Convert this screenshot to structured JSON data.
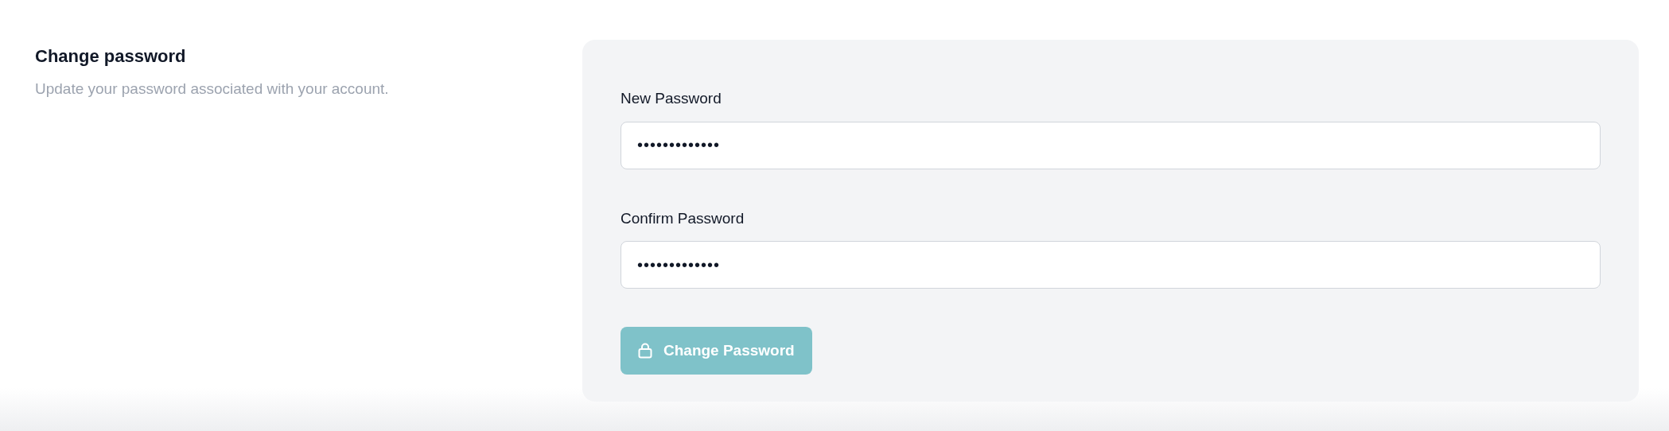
{
  "section": {
    "title": "Change password",
    "description": "Update your password associated with your account."
  },
  "fields": [
    {
      "label": "New Password",
      "value": "•••••••••••••"
    },
    {
      "label": "Confirm Password",
      "value": "•••••••••••••"
    }
  ],
  "submit": {
    "label": "Change Password",
    "disabled": true
  }
}
